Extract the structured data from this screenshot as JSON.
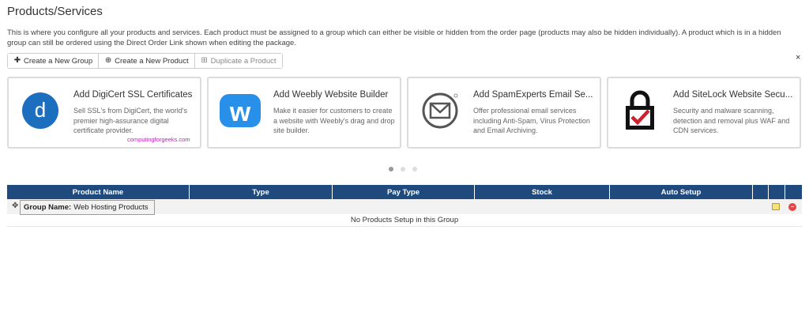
{
  "page": {
    "title": "Products/Services",
    "intro": "This is where you configure all your products and services. Each product must be assigned to a group which can either be visible or hidden from the order page (products may also be hidden individually). A product which is in a hidden group can still be ordered using the Direct Order Link shown when editing the package."
  },
  "toolbar": {
    "create_group": "Create a New Group",
    "create_product": "Create a New Product",
    "duplicate_product": "Duplicate a Product"
  },
  "close_label": "×",
  "promo_cards": [
    {
      "title": "Add DigiCert SSL Certificates",
      "desc": "Sell SSL's from DigiCert, the world's premier high-assurance digital certificate provider.",
      "logo_letter": "d",
      "icon": "digicert-logo-icon"
    },
    {
      "title": "Add Weebly Website Builder",
      "desc": "Make it easier for customers to create a website with Weebly's drag and drop site builder.",
      "logo_letter": "w",
      "icon": "weebly-logo-icon"
    },
    {
      "title": "Add SpamExperts Email Se...",
      "desc": "Offer professional email services including Anti-Spam, Virus Protection and Email Archiving.",
      "icon": "envelope-circle-icon"
    },
    {
      "title": "Add SiteLock Website Secu...",
      "desc": "Security and malware scanning, detection and removal plus WAF and CDN services.",
      "icon": "padlock-check-icon"
    }
  ],
  "watermark": "computingforgeeks.com",
  "carousel": {
    "pages": 3,
    "active": 1
  },
  "table": {
    "headers": [
      "Product Name",
      "Type",
      "Pay Type",
      "Stock",
      "Auto Setup",
      "",
      ""
    ],
    "group": {
      "label": "Group Name:",
      "name": "Web Hosting Products"
    },
    "empty_message": "No Products Setup in this Group"
  },
  "colors": {
    "table_header": "#1e4a7e",
    "digicert_blue": "#1b6fbe",
    "weebly_blue": "#2990ea",
    "sitelock_red": "#d0202e",
    "highlight_border": "#e87a7a",
    "watermark": "#c020c0"
  }
}
